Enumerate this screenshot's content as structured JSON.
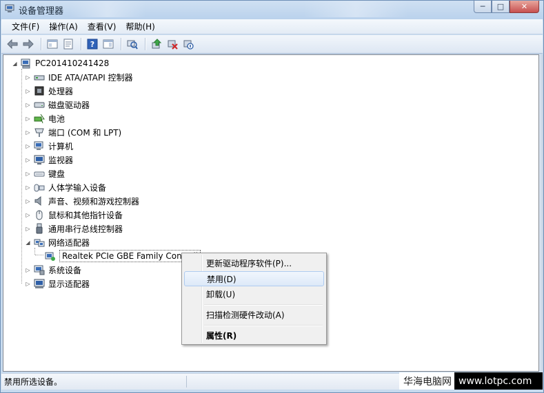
{
  "window": {
    "title": "设备管理器",
    "caption_buttons": {
      "minimize": "─",
      "maximize": "□",
      "close": "✕"
    }
  },
  "menu": [
    "文件(F)",
    "操作(A)",
    "查看(V)",
    "帮助(H)"
  ],
  "toolbar": {
    "icons": [
      "back-arrow-icon",
      "forward-arrow-icon",
      "show-hide-tree-icon",
      "properties-icon",
      "help-icon",
      "show-action-pane-icon",
      "scan-hardware-icon",
      "update-driver-icon",
      "uninstall-icon",
      "disable-icon"
    ]
  },
  "tree": {
    "root": "PC201410241428",
    "items": [
      {
        "label": "IDE ATA/ATAPI 控制器",
        "icon": "ide-controller-icon"
      },
      {
        "label": "处理器",
        "icon": "processor-icon"
      },
      {
        "label": "磁盘驱动器",
        "icon": "disk-drive-icon"
      },
      {
        "label": "电池",
        "icon": "battery-icon"
      },
      {
        "label": "端口 (COM 和 LPT)",
        "icon": "port-icon"
      },
      {
        "label": "计算机",
        "icon": "computer-icon"
      },
      {
        "label": "监视器",
        "icon": "monitor-icon"
      },
      {
        "label": "键盘",
        "icon": "keyboard-icon"
      },
      {
        "label": "人体学输入设备",
        "icon": "hid-icon"
      },
      {
        "label": "声音、视频和游戏控制器",
        "icon": "sound-icon"
      },
      {
        "label": "鼠标和其他指针设备",
        "icon": "mouse-icon"
      },
      {
        "label": "通用串行总线控制器",
        "icon": "usb-icon"
      },
      {
        "label": "网络适配器",
        "icon": "network-adapter-icon"
      },
      {
        "label": "Realtek PCIe GBE Family Controll",
        "icon": "network-card-icon"
      },
      {
        "label": "系统设备",
        "icon": "system-device-icon"
      },
      {
        "label": "显示适配器",
        "icon": "display-adapter-icon"
      }
    ]
  },
  "context_menu": {
    "items": [
      "更新驱动程序软件(P)...",
      "禁用(D)",
      "卸载(U)",
      "扫描检测硬件改动(A)",
      "属性(R)"
    ]
  },
  "statusbar": {
    "text": "禁用所选设备。"
  },
  "watermark": {
    "cn": "华海电脑网",
    "url": "www.lotpc.com"
  },
  "colors": {
    "accent": "#3d6fb6",
    "selection_hover": "#dde9f8",
    "close_button": "#c75050"
  }
}
